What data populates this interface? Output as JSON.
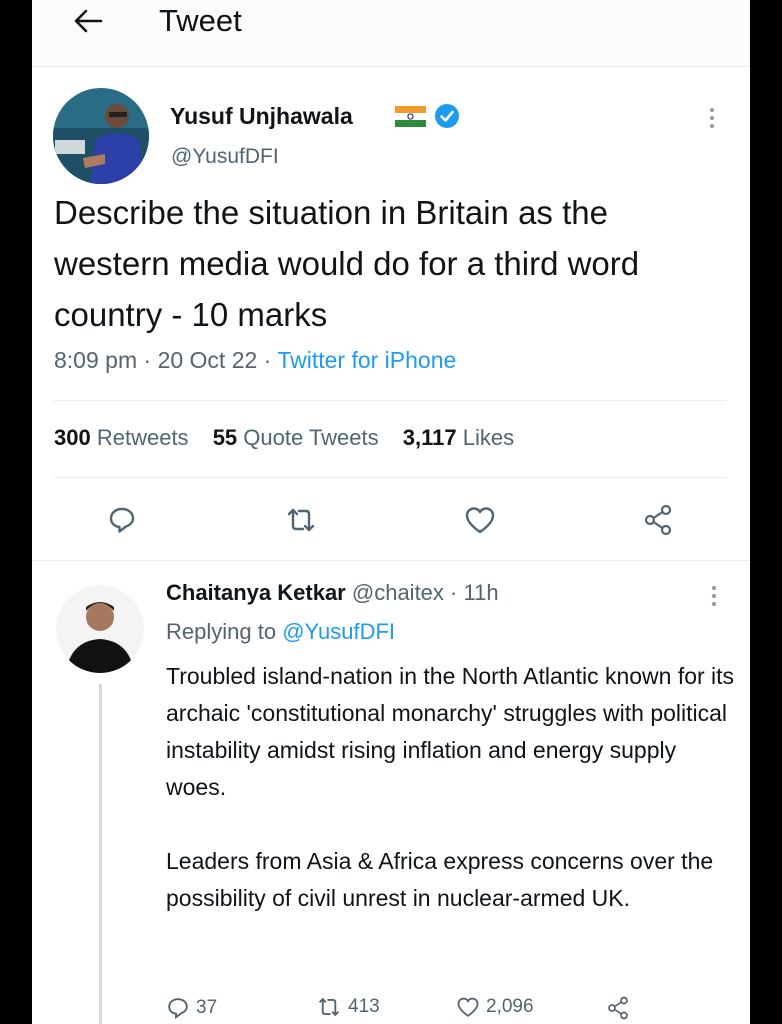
{
  "header": {
    "title": "Tweet",
    "back_icon": "arrow-left-icon"
  },
  "tweet": {
    "author_name": "Yusuf Unjhawala",
    "author_handle": "@YusufDFI",
    "text": "Describe the situation in Britain as the western media would do for a third word country - 10 marks",
    "time": "8:09 pm",
    "date": "20 Oct 22",
    "source": "Twitter for iPhone",
    "separator": " · ",
    "stats": {
      "retweets_count": "300",
      "retweets_label": "Retweets",
      "quotes_count": "55",
      "quotes_label": "Quote Tweets",
      "likes_count": "3,117",
      "likes_label": "Likes"
    }
  },
  "reply": {
    "author_name": "Chaitanya Ketkar",
    "author_handle": "@chaitex",
    "age": "11h",
    "replying_label": "Replying to",
    "replying_to": "@YusufDFI",
    "paragraph_1": "Troubled island-nation in the North Atlantic known for its archaic 'constitutional monarchy' struggles with political instability amidst rising inflation and energy supply woes.",
    "paragraph_2": "Leaders from Asia & Africa express concerns over the possibility of civil unrest in nuclear-armed UK.",
    "reply_count": "37",
    "retweet_count": "413",
    "like_count": "2,096"
  },
  "colors": {
    "accent": "#1d9bf0",
    "secondary_text": "#536471",
    "primary_text": "#0f1419",
    "divider": "#e6ecf0"
  }
}
